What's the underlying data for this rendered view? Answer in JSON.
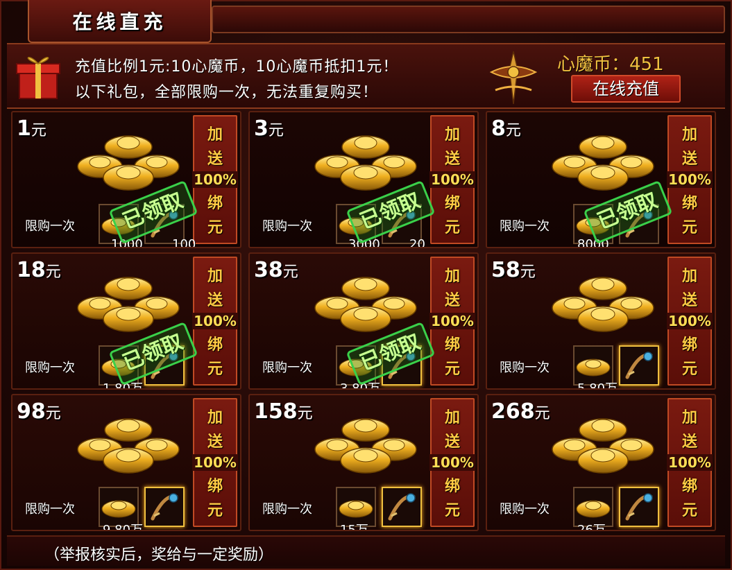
{
  "title": "在线直充",
  "notice": {
    "line1": "充值比例1元:10心魔币，10心魔币抵扣1元！",
    "line2": "以下礼包，全部限购一次，无法重复购买！"
  },
  "currency": {
    "label": "心魔币：",
    "value": "451"
  },
  "recharge_button": "在线充值",
  "banner": {
    "char1": "加",
    "char2": "送",
    "pct": "100%",
    "char3": "绑",
    "char4": "元"
  },
  "limit_label": "限购一次",
  "claimed_label": "已领取",
  "packages": [
    {
      "price": "1",
      "unit": "元",
      "qty1": "1000",
      "qty2": "100",
      "claimed": true
    },
    {
      "price": "3",
      "unit": "元",
      "qty1": "3000",
      "qty2": "20",
      "claimed": true
    },
    {
      "price": "8",
      "unit": "元",
      "qty1": "8000",
      "qty2": "",
      "claimed": true
    },
    {
      "price": "18",
      "unit": "元",
      "qty1": "1.80万",
      "qty2": "",
      "claimed": true
    },
    {
      "price": "38",
      "unit": "元",
      "qty1": "3.80万",
      "qty2": "",
      "claimed": true
    },
    {
      "price": "58",
      "unit": "元",
      "qty1": "5.80万",
      "qty2": "",
      "claimed": false
    },
    {
      "price": "98",
      "unit": "元",
      "qty1": "9.80万",
      "qty2": "",
      "claimed": false
    },
    {
      "price": "158",
      "unit": "元",
      "qty1": "15万",
      "qty2": "",
      "claimed": false
    },
    {
      "price": "268",
      "unit": "元",
      "qty1": "26万",
      "qty2": "",
      "claimed": false
    }
  ],
  "footer_note": "（举报核实后，奖给与一定奖励）",
  "colors": {
    "gold": "#f0c040",
    "stamp_green": "#3ad04a",
    "banner_red": "#7a1a10"
  }
}
